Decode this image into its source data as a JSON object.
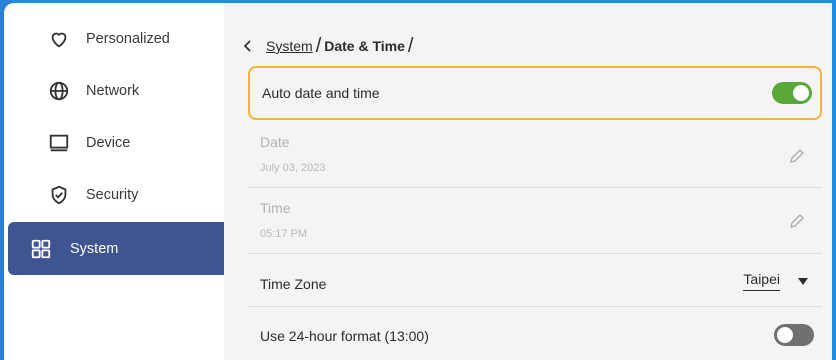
{
  "sidebar": {
    "items": [
      {
        "label": "Personalized",
        "icon": "heart-icon"
      },
      {
        "label": "Network",
        "icon": "globe-icon"
      },
      {
        "label": "Device",
        "icon": "monitor-icon"
      },
      {
        "label": "Security",
        "icon": "shield-check-icon"
      },
      {
        "label": "System",
        "icon": "grid-icon",
        "active": true
      }
    ]
  },
  "breadcrumb": {
    "parent": "System",
    "separator": "/",
    "current": "Date & Time",
    "trailing": "/"
  },
  "settings": {
    "auto_date_time": {
      "label": "Auto date and time",
      "enabled": true
    },
    "date": {
      "label": "Date",
      "value": "July 03, 2023"
    },
    "time": {
      "label": "Time",
      "value": "05:17 PM"
    },
    "time_zone": {
      "label": "Time Zone",
      "value": "Taipei"
    },
    "use_24_hour": {
      "label": "Use 24-hour format (13:00)",
      "enabled": false
    }
  },
  "colors": {
    "accent_active_nav": "#3f5592",
    "toggle_on": "#5aa83a",
    "toggle_off": "#707070",
    "focus_border": "#f2b33a",
    "frame_blue": "#1a8fe6"
  }
}
